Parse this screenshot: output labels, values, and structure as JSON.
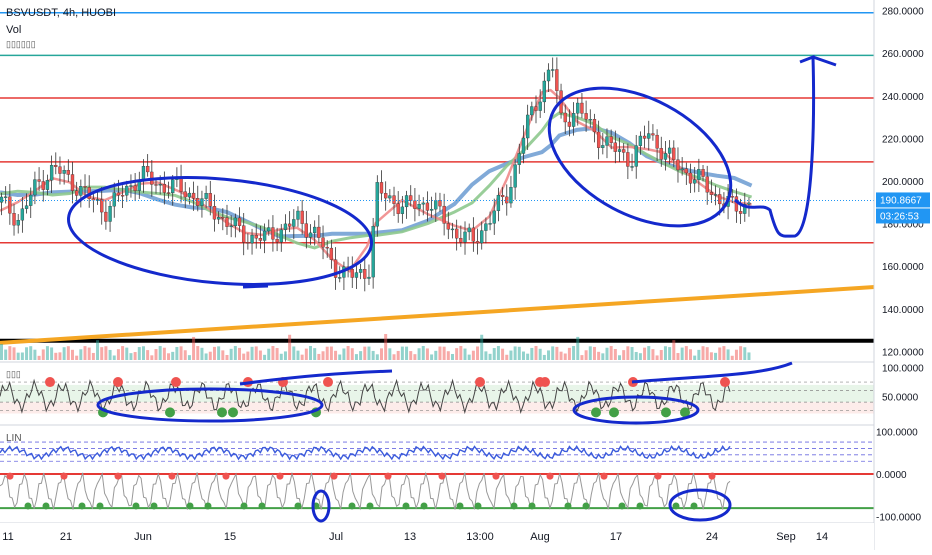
{
  "header": {
    "symbol_line": "BSVUSDT, 4h, HUOBI",
    "vol_label": "Vol",
    "garbled_label": "▯▯▯▯▯▯",
    "osc1_label": "▯▯▯",
    "lin_label": "LIN"
  },
  "colors": {
    "up": "#26a69a",
    "down": "#ef5350",
    "accent": "#2196f3",
    "axis_text": "#131722",
    "hline_red": "#e53935",
    "trendline": "#f5a623",
    "annotation": "#1429cc",
    "ma_red": "#ef8a8a",
    "ma_green": "#8ec98e",
    "ma_blue": "#6b9bd1"
  },
  "chart_data": [
    {
      "type": "candlestick",
      "symbol": "BSVUSDT",
      "interval": "4h",
      "exchange": "HUOBI",
      "ylim": [
        115,
        285
      ],
      "price_ticks": [
        "280.0000",
        "260.0000",
        "240.0000",
        "220.0000",
        "200.0000",
        "180.0000",
        "160.0000",
        "140.0000",
        "120.0000"
      ],
      "price_tick_values": [
        280,
        260,
        240,
        220,
        200,
        180,
        160,
        140,
        120
      ],
      "x_tick_labels": [
        "11",
        "21",
        "Jun",
        "15",
        "Jul",
        "13",
        "13:00",
        "Aug",
        "17",
        "24",
        "Sep",
        "14"
      ],
      "last_price": "190.8667",
      "countdown": "03:26:53",
      "horizontal_levels": [
        {
          "value": 279,
          "color": "#2196f3"
        },
        {
          "value": 259,
          "color": "#26a69a"
        },
        {
          "value": 239,
          "color": "#e53935"
        },
        {
          "value": 209,
          "color": "#e53935"
        },
        {
          "value": 171,
          "color": "#e53935"
        },
        {
          "value": 125,
          "color": "#000000"
        }
      ],
      "price_path": [
        [
          0,
          190
        ],
        [
          0.02,
          182
        ],
        [
          0.04,
          198
        ],
        [
          0.06,
          206
        ],
        [
          0.08,
          200
        ],
        [
          0.1,
          192
        ],
        [
          0.12,
          186
        ],
        [
          0.14,
          195
        ],
        [
          0.16,
          203
        ],
        [
          0.18,
          198
        ],
        [
          0.2,
          197
        ],
        [
          0.22,
          193
        ],
        [
          0.24,
          187
        ],
        [
          0.26,
          180
        ],
        [
          0.28,
          174
        ],
        [
          0.3,
          173
        ],
        [
          0.32,
          177
        ],
        [
          0.34,
          182
        ],
        [
          0.36,
          175
        ],
        [
          0.38,
          160
        ],
        [
          0.4,
          155
        ],
        [
          0.42,
          158
        ],
        [
          0.43,
          195
        ],
        [
          0.46,
          188
        ],
        [
          0.49,
          190
        ],
        [
          0.52,
          175
        ],
        [
          0.54,
          172
        ],
        [
          0.56,
          183
        ],
        [
          0.58,
          195
        ],
        [
          0.6,
          225
        ],
        [
          0.62,
          245
        ],
        [
          0.63,
          255
        ],
        [
          0.64,
          228
        ],
        [
          0.66,
          234
        ],
        [
          0.68,
          222
        ],
        [
          0.7,
          215
        ],
        [
          0.72,
          210
        ],
        [
          0.74,
          223
        ],
        [
          0.76,
          212
        ],
        [
          0.78,
          205
        ],
        [
          0.8,
          200
        ],
        [
          0.82,
          192
        ],
        [
          0.84,
          187
        ],
        [
          0.86,
          191
        ]
      ]
    },
    {
      "type": "line",
      "name": "",
      "yticks": [
        "100.0000",
        "50.0000"
      ],
      "ytick_values": [
        100,
        50
      ],
      "ylim": [
        0,
        110
      ]
    },
    {
      "type": "line",
      "name": "LIN",
      "yticks": [
        "100.0000",
        "0.0000",
        "-100.0000"
      ],
      "ytick_values": [
        100,
        0,
        -100
      ],
      "ylim": [
        -115,
        115
      ]
    }
  ]
}
